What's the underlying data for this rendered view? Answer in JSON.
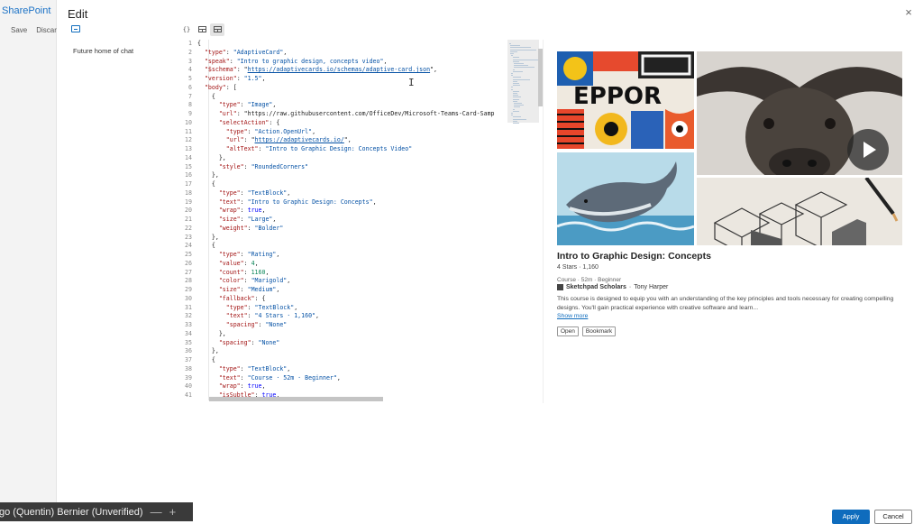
{
  "background": {
    "brand": "SharePoint",
    "actions": [
      "Save",
      "Discard"
    ]
  },
  "panel": {
    "title": "Edit",
    "close_glyph": "×",
    "chat_placeholder": "Future home of chat",
    "toolbar": {
      "json_glyph": "{}",
      "icons": [
        "json-view-icon",
        "split-view-icon",
        "preview-view-icon"
      ]
    }
  },
  "editor": {
    "lines": [
      "{",
      "  \"type\": \"AdaptiveCard\",",
      "  \"speak\": \"Intro to graphic design, concepts video\",",
      "  \"$schema\": \"https://adaptivecards.io/schemas/adaptive-card.json\",",
      "  \"version\": \"1.5\",",
      "  \"body\": [",
      "    {",
      "      \"type\": \"Image\",",
      "      \"url\": \"https://raw.githubusercontent.com/OfficeDev/Microsoft-Teams-Card-Samp",
      "      \"selectAction\": {",
      "        \"type\": \"Action.OpenUrl\",",
      "        \"url\": \"https://adaptivecards.io/\",",
      "        \"altText\": \"Intro to Graphic Design: Concepts Video\"",
      "      },",
      "      \"style\": \"RoundedCorners\"",
      "    },",
      "    {",
      "      \"type\": \"TextBlock\",",
      "      \"text\": \"Intro to Graphic Design: Concepts\",",
      "      \"wrap\": true,",
      "      \"size\": \"Large\",",
      "      \"weight\": \"Bolder\"",
      "    },",
      "    {",
      "      \"type\": \"Rating\",",
      "      \"value\": 4,",
      "      \"count\": 1160,",
      "      \"color\": \"Marigold\",",
      "      \"size\": \"Medium\",",
      "      \"fallback\": {",
      "        \"type\": \"TextBlock\",",
      "        \"text\": \"4 Stars · 1,160\",",
      "        \"spacing\": \"None\"",
      "      },",
      "      \"spacing\": \"None\"",
      "    },",
      "    {",
      "      \"type\": \"TextBlock\",",
      "      \"text\": \"Course · 52m · Beginner\",",
      "      \"wrap\": true,",
      "      \"isSubtle\": true,"
    ]
  },
  "card": {
    "title": "Intro to Graphic Design: Concepts",
    "rating_text": "4 Stars · 1,160",
    "meta": "Course · 52m · Beginner",
    "publisher": "Sketchpad Scholars",
    "separator": "·",
    "author": "Tony Harper",
    "description": "This course is designed to equip you with an understanding of the key principles and tools necessary for creating compelling designs. You'll gain practical experience with creative software and learn...",
    "show_more": "Show more",
    "buttons": [
      "Open",
      "Bookmark"
    ]
  },
  "footer": {
    "apply": "Apply",
    "cancel": "Cancel"
  },
  "meeting": {
    "participant": "go (Quentin) Bernier (Unverified)",
    "controls": [
      "—",
      "+"
    ]
  },
  "colors": {
    "accent": "#0f6cbd",
    "json_key": "#a31515",
    "json_string": "#0451a5",
    "json_number": "#098658",
    "json_bool": "#0000ff"
  }
}
